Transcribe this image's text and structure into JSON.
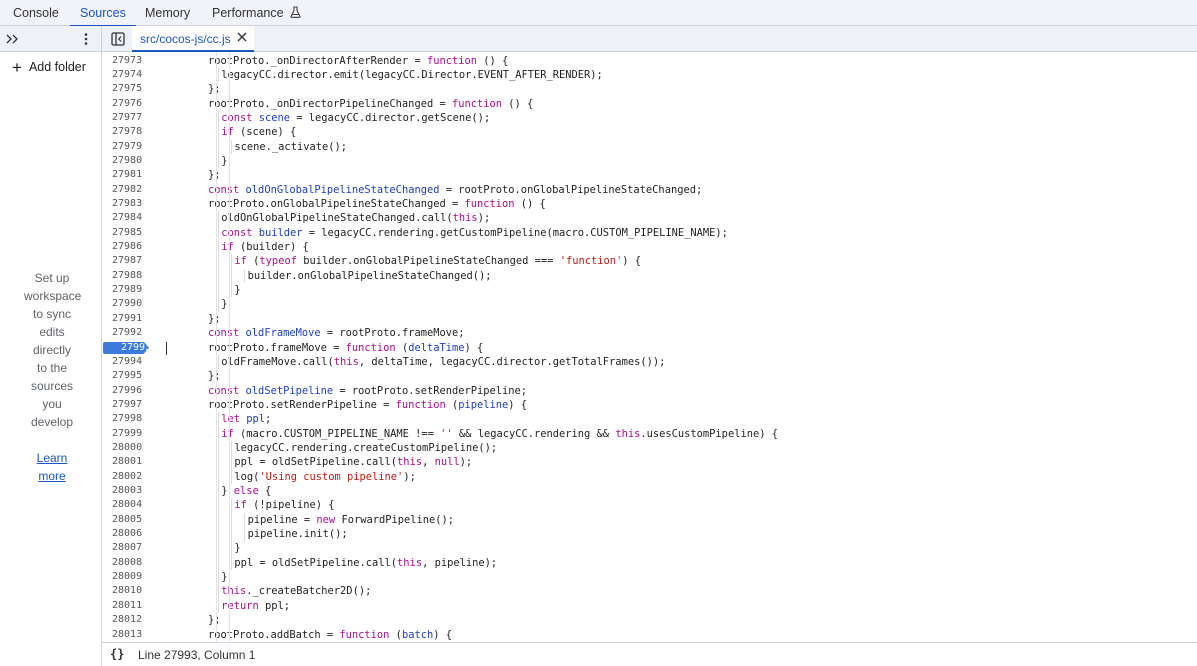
{
  "tabs": [
    {
      "label": "Console"
    },
    {
      "label": "Sources",
      "active": true
    },
    {
      "label": "Memory"
    },
    {
      "label": "Performance",
      "flask_icon": "flask-icon"
    }
  ],
  "navigator": {
    "more_icon": "chevron-double-right-icon",
    "menu_icon": "kebab-menu-icon"
  },
  "file_tab": {
    "toggle_icon": "toggle-sidebar-icon",
    "name": "src/cocos-js/cc.js",
    "close_icon": "close-icon"
  },
  "left_panel": {
    "add_folder": "Add folder",
    "workspace_text": [
      "Set up",
      "workspace",
      "to sync",
      "edits",
      "directly",
      "to the",
      "sources",
      "you",
      "develop"
    ],
    "learn_more": [
      "Learn",
      "more"
    ]
  },
  "editor": {
    "breakpoint_line": "27993",
    "lines": [
      {
        "n": "27973",
        "indent": 2,
        "segs": [
          [
            "rootProto._onDirectorAfterRender = ",
            "p"
          ],
          [
            "function",
            "k"
          ],
          [
            " () {",
            "p"
          ]
        ]
      },
      {
        "n": "27974",
        "indent": 3,
        "segs": [
          [
            "legacyCC.director.emit(legacyCC.Director.EVENT_AFTER_RENDER);",
            "p"
          ]
        ]
      },
      {
        "n": "27975",
        "indent": 2,
        "segs": [
          [
            "};",
            "p"
          ]
        ]
      },
      {
        "n": "27976",
        "indent": 2,
        "segs": [
          [
            "rootProto._onDirectorPipelineChanged = ",
            "p"
          ],
          [
            "function",
            "k"
          ],
          [
            " () {",
            "p"
          ]
        ]
      },
      {
        "n": "27977",
        "indent": 3,
        "segs": [
          [
            "const",
            "k"
          ],
          [
            " ",
            "p"
          ],
          [
            "scene",
            "v"
          ],
          [
            " = legacyCC.director.getScene();",
            "p"
          ]
        ]
      },
      {
        "n": "27978",
        "indent": 3,
        "segs": [
          [
            "if",
            "k"
          ],
          [
            " (scene) {",
            "p"
          ]
        ]
      },
      {
        "n": "27979",
        "indent": 4,
        "segs": [
          [
            "scene._activate();",
            "p"
          ]
        ]
      },
      {
        "n": "27980",
        "indent": 3,
        "segs": [
          [
            "}",
            "p"
          ]
        ]
      },
      {
        "n": "27981",
        "indent": 2,
        "segs": [
          [
            "};",
            "p"
          ]
        ]
      },
      {
        "n": "27982",
        "indent": 2,
        "segs": [
          [
            "const",
            "k"
          ],
          [
            " ",
            "p"
          ],
          [
            "oldOnGlobalPipelineStateChanged",
            "v"
          ],
          [
            " = rootProto.onGlobalPipelineStateChanged;",
            "p"
          ]
        ]
      },
      {
        "n": "27983",
        "indent": 2,
        "segs": [
          [
            "rootProto.onGlobalPipelineStateChanged = ",
            "p"
          ],
          [
            "function",
            "k"
          ],
          [
            " () {",
            "p"
          ]
        ]
      },
      {
        "n": "27984",
        "indent": 3,
        "segs": [
          [
            "oldOnGlobalPipelineStateChanged.call(",
            "p"
          ],
          [
            "this",
            "k"
          ],
          [
            ");",
            "p"
          ]
        ]
      },
      {
        "n": "27985",
        "indent": 3,
        "segs": [
          [
            "const",
            "k"
          ],
          [
            " ",
            "p"
          ],
          [
            "builder",
            "v"
          ],
          [
            " = legacyCC.rendering.getCustomPipeline(macro.CUSTOM_PIPELINE_NAME);",
            "p"
          ]
        ]
      },
      {
        "n": "27986",
        "indent": 3,
        "segs": [
          [
            "if",
            "k"
          ],
          [
            " (builder) {",
            "p"
          ]
        ]
      },
      {
        "n": "27987",
        "indent": 4,
        "segs": [
          [
            "if",
            "k"
          ],
          [
            " (",
            "p"
          ],
          [
            "typeof",
            "k"
          ],
          [
            " builder.onGlobalPipelineStateChanged === ",
            "p"
          ],
          [
            "'function'",
            "s"
          ],
          [
            ") {",
            "p"
          ]
        ]
      },
      {
        "n": "27988",
        "indent": 5,
        "segs": [
          [
            "builder.onGlobalPipelineStateChanged();",
            "p"
          ]
        ]
      },
      {
        "n": "27989",
        "indent": 4,
        "segs": [
          [
            "}",
            "p"
          ]
        ]
      },
      {
        "n": "27990",
        "indent": 3,
        "segs": [
          [
            "}",
            "p"
          ]
        ]
      },
      {
        "n": "27991",
        "indent": 2,
        "segs": [
          [
            "};",
            "p"
          ]
        ]
      },
      {
        "n": "27992",
        "indent": 2,
        "segs": [
          [
            "const",
            "k"
          ],
          [
            " ",
            "p"
          ],
          [
            "oldFrameMove",
            "v"
          ],
          [
            " = rootProto.frameMove;",
            "p"
          ]
        ]
      },
      {
        "n": "27993",
        "indent": 2,
        "segs": [
          [
            "rootProto.frameMove = ",
            "p"
          ],
          [
            "function",
            "k"
          ],
          [
            " (",
            "p"
          ],
          [
            "deltaTime",
            "v"
          ],
          [
            ") {",
            "p"
          ]
        ]
      },
      {
        "n": "27994",
        "indent": 3,
        "segs": [
          [
            "oldFrameMove.call(",
            "p"
          ],
          [
            "this",
            "k"
          ],
          [
            ", deltaTime, legacyCC.director.getTotalFrames());",
            "p"
          ]
        ]
      },
      {
        "n": "27995",
        "indent": 2,
        "segs": [
          [
            "};",
            "p"
          ]
        ]
      },
      {
        "n": "27996",
        "indent": 2,
        "segs": [
          [
            "const",
            "k"
          ],
          [
            " ",
            "p"
          ],
          [
            "oldSetPipeline",
            "v"
          ],
          [
            " = rootProto.setRenderPipeline;",
            "p"
          ]
        ]
      },
      {
        "n": "27997",
        "indent": 2,
        "segs": [
          [
            "rootProto.setRenderPipeline = ",
            "p"
          ],
          [
            "function",
            "k"
          ],
          [
            " (",
            "p"
          ],
          [
            "pipeline",
            "v"
          ],
          [
            ") {",
            "p"
          ]
        ]
      },
      {
        "n": "27998",
        "indent": 3,
        "segs": [
          [
            "let",
            "k"
          ],
          [
            " ",
            "p"
          ],
          [
            "ppl",
            "v"
          ],
          [
            ";",
            "p"
          ]
        ]
      },
      {
        "n": "27999",
        "indent": 3,
        "segs": [
          [
            "if",
            "k"
          ],
          [
            " (macro.CUSTOM_PIPELINE_NAME !== ",
            "p"
          ],
          [
            "''",
            "s"
          ],
          [
            " && legacyCC.rendering && ",
            "p"
          ],
          [
            "this",
            "k"
          ],
          [
            ".usesCustomPipeline) {",
            "p"
          ]
        ]
      },
      {
        "n": "28000",
        "indent": 4,
        "segs": [
          [
            "legacyCC.rendering.createCustomPipeline();",
            "p"
          ]
        ]
      },
      {
        "n": "28001",
        "indent": 4,
        "segs": [
          [
            "ppl = oldSetPipeline.call(",
            "p"
          ],
          [
            "this",
            "k"
          ],
          [
            ", ",
            "p"
          ],
          [
            "null",
            "k"
          ],
          [
            ");",
            "p"
          ]
        ]
      },
      {
        "n": "28002",
        "indent": 4,
        "segs": [
          [
            "log(",
            "p"
          ],
          [
            "'Using custom pipeline'",
            "s"
          ],
          [
            ");",
            "p"
          ]
        ]
      },
      {
        "n": "28003",
        "indent": 3,
        "segs": [
          [
            "} ",
            "p"
          ],
          [
            "else",
            "k"
          ],
          [
            " {",
            "p"
          ]
        ]
      },
      {
        "n": "28004",
        "indent": 4,
        "segs": [
          [
            "if",
            "k"
          ],
          [
            " (!pipeline) {",
            "p"
          ]
        ]
      },
      {
        "n": "28005",
        "indent": 5,
        "segs": [
          [
            "pipeline = ",
            "p"
          ],
          [
            "new",
            "k"
          ],
          [
            " ForwardPipeline();",
            "p"
          ]
        ]
      },
      {
        "n": "28006",
        "indent": 5,
        "segs": [
          [
            "pipeline.init();",
            "p"
          ]
        ]
      },
      {
        "n": "28007",
        "indent": 4,
        "segs": [
          [
            "}",
            "p"
          ]
        ]
      },
      {
        "n": "28008",
        "indent": 4,
        "segs": [
          [
            "ppl = oldSetPipeline.call(",
            "p"
          ],
          [
            "this",
            "k"
          ],
          [
            ", pipeline);",
            "p"
          ]
        ]
      },
      {
        "n": "28009",
        "indent": 3,
        "segs": [
          [
            "}",
            "p"
          ]
        ]
      },
      {
        "n": "28010",
        "indent": 3,
        "segs": [
          [
            "this",
            "k"
          ],
          [
            "._createBatcher2D();",
            "p"
          ]
        ]
      },
      {
        "n": "28011",
        "indent": 3,
        "segs": [
          [
            "return",
            "k"
          ],
          [
            " ppl;",
            "p"
          ]
        ]
      },
      {
        "n": "28012",
        "indent": 2,
        "segs": [
          [
            "};",
            "p"
          ]
        ]
      },
      {
        "n": "28013",
        "indent": 2,
        "segs": [
          [
            "rootProto.addBatch = ",
            "p"
          ],
          [
            "function",
            "k"
          ],
          [
            " (",
            "p"
          ],
          [
            "batch",
            "v"
          ],
          [
            ") {",
            "p"
          ]
        ]
      }
    ]
  },
  "status": {
    "braces": "{}",
    "position": "Line 27993, Column 1"
  },
  "colors": {
    "keyword": "#aa0d91",
    "variable": "#1c3ec4",
    "string": "#c41a16",
    "accent": "#1a56c4",
    "breakpoint": "#3a7bdc"
  }
}
